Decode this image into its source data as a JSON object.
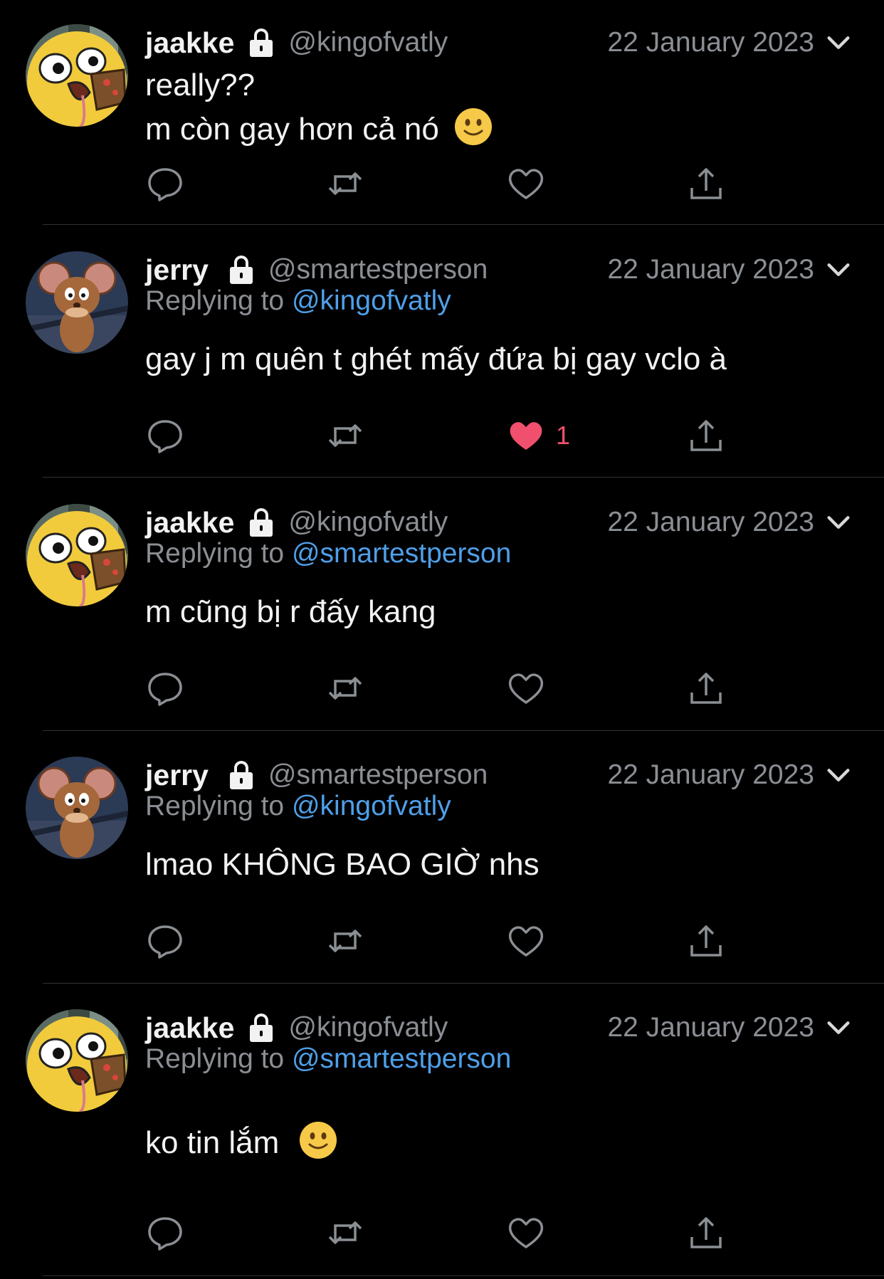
{
  "tweets": [
    {
      "name": "jaakke",
      "handle": "@kingofvatly",
      "date": "22 January 2023",
      "avatar": "jake-avatar",
      "replying_label": "",
      "replying_to": "",
      "body_lines": [
        "really??",
        "m còn gay hơn cả nó"
      ],
      "body_emoji": "slightly-smiling-face",
      "liked": false,
      "like_count": ""
    },
    {
      "name": "jerry",
      "handle": "@smartestperson",
      "date": "22 January 2023",
      "avatar": "jerry-avatar",
      "replying_label": "Replying to ",
      "replying_to": "@kingofvatly",
      "body_lines": [
        "gay j m quên t ghét mấy đứa bị gay vclo à"
      ],
      "liked": true,
      "like_count": "1"
    },
    {
      "name": "jaakke",
      "handle": "@kingofvatly",
      "date": "22 January 2023",
      "avatar": "jake-avatar",
      "replying_label": "Replying to ",
      "replying_to": "@smartestperson",
      "body_lines": [
        "m cũng bị r đấy kang"
      ],
      "liked": false,
      "like_count": ""
    },
    {
      "name": "jerry",
      "handle": "@smartestperson",
      "date": "22 January 2023",
      "avatar": "jerry-avatar",
      "replying_label": "Replying to ",
      "replying_to": "@kingofvatly",
      "body_lines": [
        "lmao KHÔNG BAO GIỜ nhs"
      ],
      "liked": false,
      "like_count": ""
    },
    {
      "name": "jaakke",
      "handle": "@kingofvatly",
      "date": "22 January 2023",
      "avatar": "jake-avatar",
      "replying_label": "Replying to ",
      "replying_to": "@smartestperson",
      "body_lines": [
        "ko tin lắm"
      ],
      "body_emoji": "slightly-smiling-face",
      "liked": false,
      "like_count": ""
    }
  ],
  "icons": {
    "reply": "reply-icon",
    "retweet": "retweet-icon",
    "like": "heart-icon",
    "share": "share-icon",
    "lock": "lock-icon",
    "menu": "chevron-down-icon"
  },
  "colors": {
    "background": "#000000",
    "text": "#f2f2f2",
    "secondary": "#8b8f94",
    "link": "#4f9fe8",
    "like": "#f0506e",
    "divider": "#2f3336"
  }
}
